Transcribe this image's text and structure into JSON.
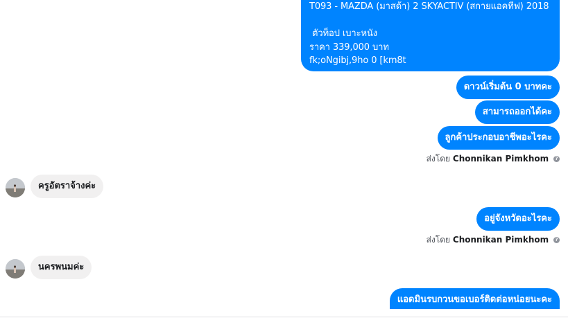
{
  "conversation": {
    "product_message": {
      "line1": "T093 - MAZDA (มาสด้า) 2 SKYACTIV (สกายแอคทีฟ) 2018",
      "line2": "",
      "line3": " ตัวท็อป เบาะหนัง",
      "line4": "ราคา 339,000 บาท",
      "line5": "fk;oNgibj,9ho 0 [km8t"
    },
    "out_1": "ดาวน์เริ่มต้น 0 บาทคะ",
    "out_2": "สามารถออกได้คะ",
    "out_3": "ลูกค้าประกอบอาชีพอะไรคะ",
    "sent_by_1": {
      "prefix": "ส่งโดย",
      "name": "Chonnikan Pimkhom"
    },
    "in_1": "ครูอัตราจ้างค่ะ",
    "out_4": "อยู่จังหวัดอะไรคะ",
    "sent_by_2": {
      "prefix": "ส่งโดย",
      "name": "Chonnikan Pimkhom"
    },
    "in_2": "นครพนมค่ะ",
    "out_5": "แอดมินรบกวนขอเบอร์ติดต่อหน่อยนะคะ",
    "info_icon": "info-icon",
    "colors": {
      "outgoing_bubble": "#0084ff",
      "incoming_bubble": "#f1f0f0"
    }
  }
}
